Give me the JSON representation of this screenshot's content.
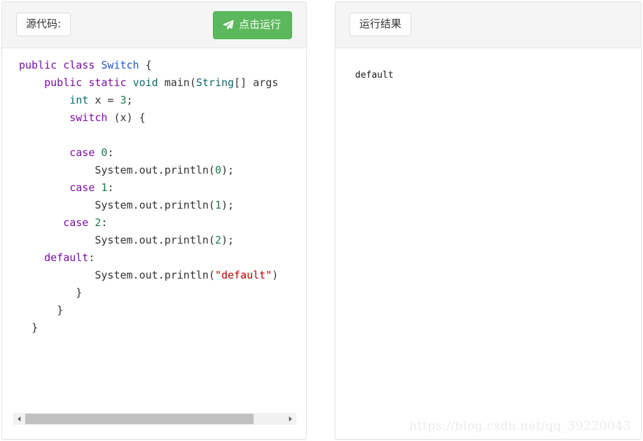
{
  "code_panel": {
    "label": "源代码:",
    "run_button": {
      "label": "点击运行",
      "icon": "paper-plane-icon",
      "color": "#5cb85c"
    },
    "language": "java",
    "code_lines": [
      {
        "indent": 0,
        "tokens": [
          {
            "t": "public",
            "c": "kw"
          },
          {
            "t": " ",
            "c": "pl"
          },
          {
            "t": "class",
            "c": "kw"
          },
          {
            "t": " ",
            "c": "pl"
          },
          {
            "t": "Switch",
            "c": "cls"
          },
          {
            "t": " {",
            "c": "pl"
          }
        ]
      },
      {
        "indent": 4,
        "tokens": [
          {
            "t": "public",
            "c": "kw"
          },
          {
            "t": " ",
            "c": "pl"
          },
          {
            "t": "static",
            "c": "kw"
          },
          {
            "t": " ",
            "c": "pl"
          },
          {
            "t": "void",
            "c": "typ"
          },
          {
            "t": " main(",
            "c": "pl"
          },
          {
            "t": "String",
            "c": "typ"
          },
          {
            "t": "[] args",
            "c": "pl"
          }
        ]
      },
      {
        "indent": 8,
        "tokens": [
          {
            "t": "int",
            "c": "typ"
          },
          {
            "t": " x = ",
            "c": "pl"
          },
          {
            "t": "3",
            "c": "num"
          },
          {
            "t": ";",
            "c": "pl"
          }
        ]
      },
      {
        "indent": 8,
        "tokens": [
          {
            "t": "switch",
            "c": "kw"
          },
          {
            "t": " (x) {",
            "c": "pl"
          }
        ]
      },
      {
        "indent": 0,
        "tokens": []
      },
      {
        "indent": 8,
        "tokens": [
          {
            "t": "case",
            "c": "kw"
          },
          {
            "t": " ",
            "c": "pl"
          },
          {
            "t": "0",
            "c": "num"
          },
          {
            "t": ":",
            "c": "pl"
          }
        ]
      },
      {
        "indent": 12,
        "tokens": [
          {
            "t": "System.out.println(",
            "c": "pl"
          },
          {
            "t": "0",
            "c": "num"
          },
          {
            "t": ");",
            "c": "pl"
          }
        ]
      },
      {
        "indent": 8,
        "tokens": [
          {
            "t": "case",
            "c": "kw"
          },
          {
            "t": " ",
            "c": "pl"
          },
          {
            "t": "1",
            "c": "num"
          },
          {
            "t": ":",
            "c": "pl"
          }
        ]
      },
      {
        "indent": 12,
        "tokens": [
          {
            "t": "System.out.println(",
            "c": "pl"
          },
          {
            "t": "1",
            "c": "num"
          },
          {
            "t": ");",
            "c": "pl"
          }
        ]
      },
      {
        "indent": 7,
        "tokens": [
          {
            "t": "case",
            "c": "kw"
          },
          {
            "t": " ",
            "c": "pl"
          },
          {
            "t": "2",
            "c": "num"
          },
          {
            "t": ":",
            "c": "pl"
          }
        ]
      },
      {
        "indent": 12,
        "tokens": [
          {
            "t": "System.out.println(",
            "c": "pl"
          },
          {
            "t": "2",
            "c": "num"
          },
          {
            "t": ");",
            "c": "pl"
          }
        ]
      },
      {
        "indent": 4,
        "tokens": [
          {
            "t": "default",
            "c": "kw"
          },
          {
            "t": ":",
            "c": "pl"
          }
        ]
      },
      {
        "indent": 12,
        "tokens": [
          {
            "t": "System.out.println(",
            "c": "pl"
          },
          {
            "t": "\"default\"",
            "c": "str"
          },
          {
            "t": ")",
            "c": "pl"
          }
        ]
      },
      {
        "indent": 9,
        "tokens": [
          {
            "t": "}",
            "c": "pl"
          }
        ]
      },
      {
        "indent": 6,
        "tokens": [
          {
            "t": "}",
            "c": "pl"
          }
        ]
      },
      {
        "indent": 2,
        "tokens": [
          {
            "t": "}",
            "c": "pl"
          }
        ]
      }
    ],
    "scrollbar": {
      "left_arrow": "triangle-left-icon",
      "right_arrow": "triangle-right-icon",
      "thumb_width_percent": 88
    }
  },
  "result_panel": {
    "label": "运行结果",
    "output": "default"
  },
  "watermark": "https://blog.csdn.net/qq_39220043"
}
